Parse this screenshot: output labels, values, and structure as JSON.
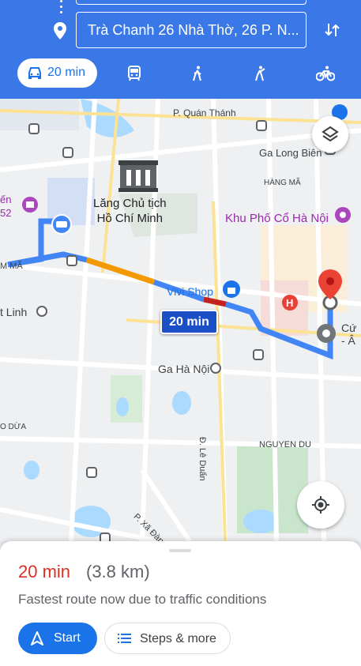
{
  "header": {
    "destination": "Trà Chanh 26 Nhà Thờ, 26 P. N...",
    "swap_icon": "swap-vertical-icon"
  },
  "modes": {
    "driving_label": "20 min",
    "items": [
      "car-icon",
      "transit-icon",
      "walk-icon",
      "rideshare-icon",
      "bicycle-icon"
    ]
  },
  "map": {
    "labels": {
      "quan_thanh": "P. Quán Thánh",
      "long_bien": "Ga Long Biên",
      "hang_ma": "HÀNG MÃ",
      "mausoleum": "Lăng Chủ tịch\nHồ Chí Minh",
      "old_quarter": "Khu Phố Cổ Hà Nội",
      "vivi": "Vivi Shop",
      "ga_hanoi": "Ga Hà Nội",
      "le_duan": "Đ. Lê Duẩn",
      "nguyen_du": "NGUYEN DU",
      "xa_dan": "P. Xã Đàn",
      "lang_partial": "ến",
      "num_partial": "52",
      "ma_partial": "M MÃ",
      "linh_partial": "t Linh",
      "o_dua_partial": "O DỪA",
      "cu_partial": "Cứ",
      "a_partial": "- Â"
    },
    "route_time_badge": "20 min"
  },
  "sheet": {
    "eta": "20 min",
    "distance": "(3.8 km)",
    "description": "Fastest route now due to traffic conditions",
    "start_label": "Start",
    "steps_label": "Steps & more"
  }
}
